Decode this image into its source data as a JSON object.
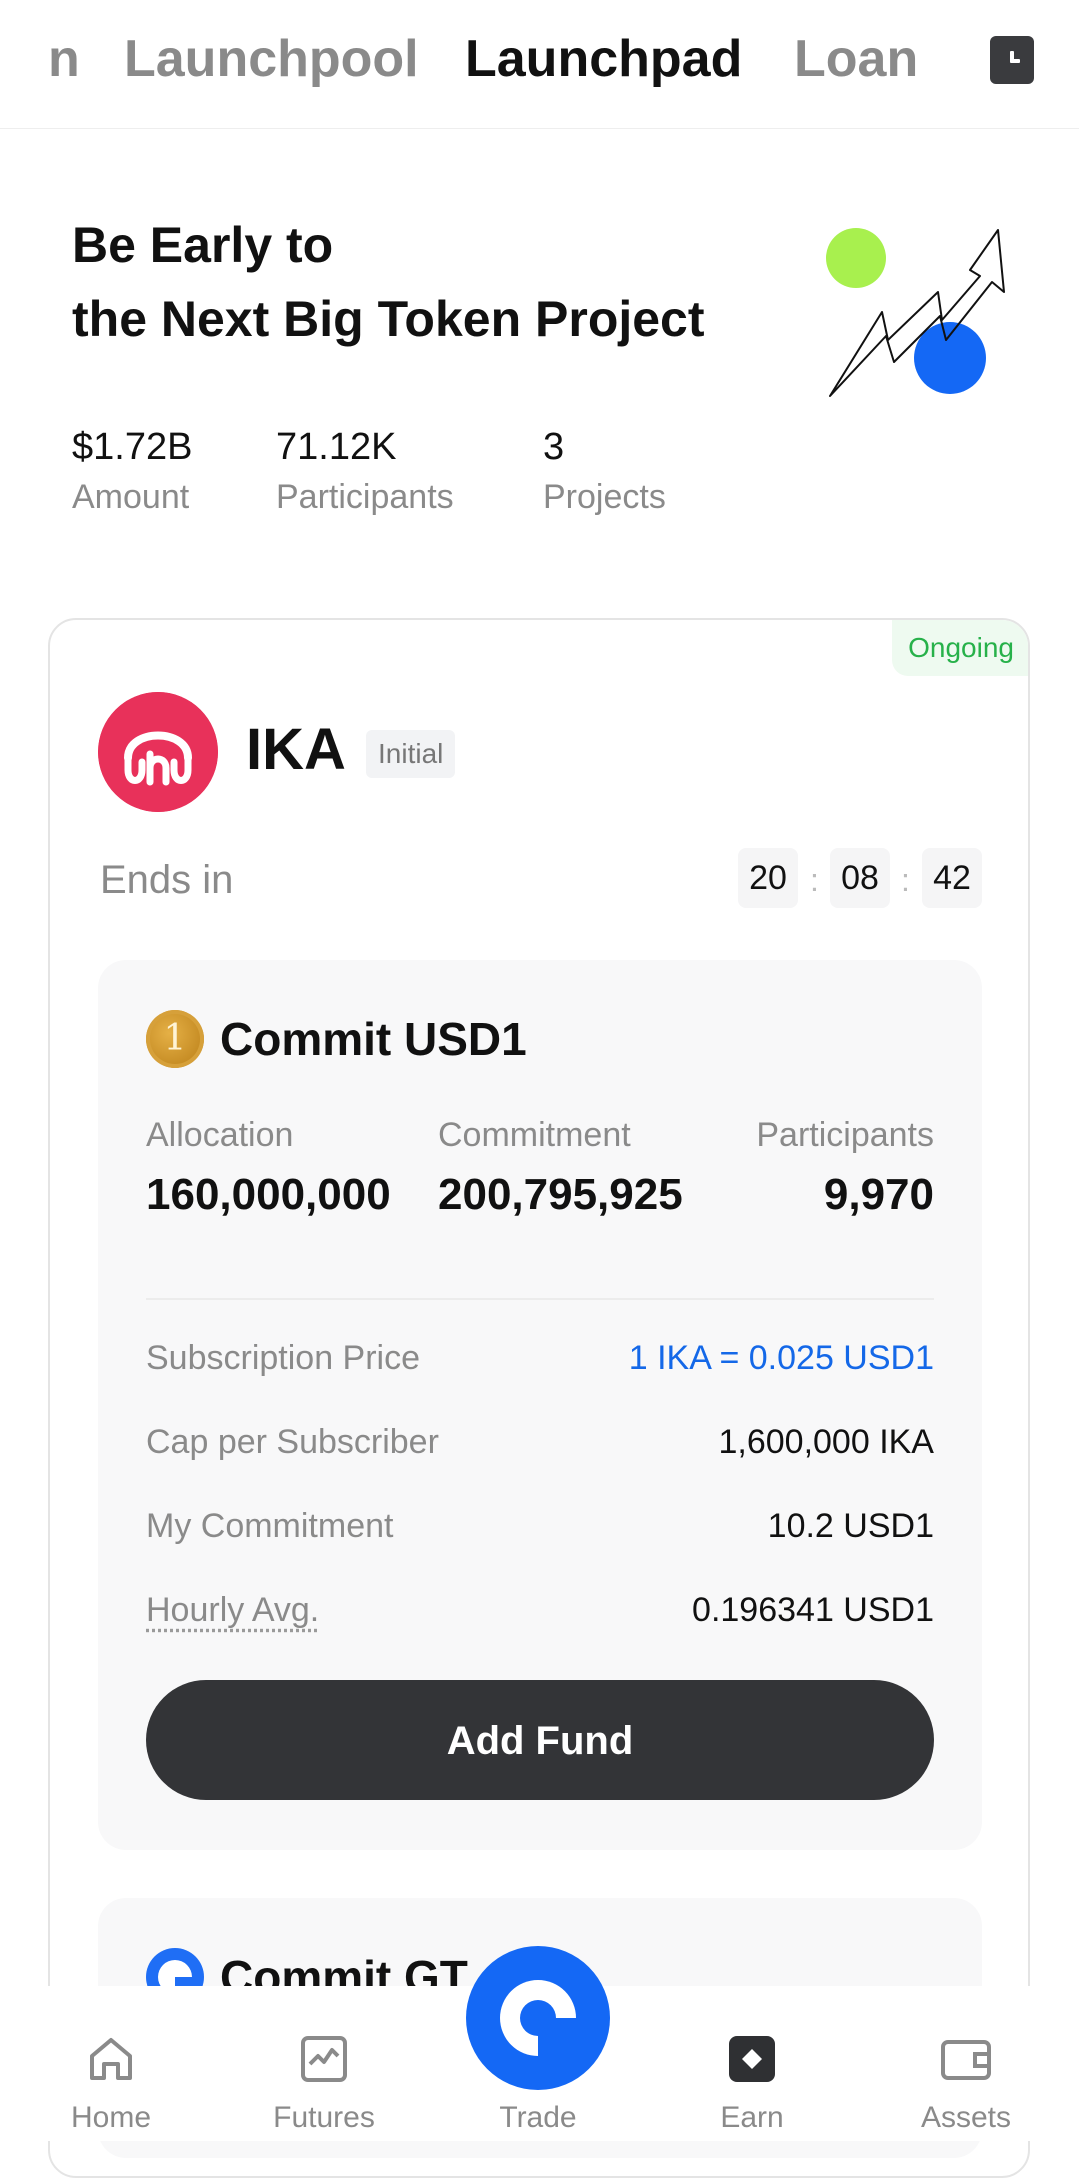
{
  "tabs": [
    {
      "label": "n"
    },
    {
      "label": "Launchpool"
    },
    {
      "label": "Launchpad"
    },
    {
      "label": "Loan"
    }
  ],
  "hero": {
    "title_line1": "Be Early to",
    "title_line2": "the Next Big Token Project"
  },
  "stats": [
    {
      "value": "$1.72B",
      "label": "Amount"
    },
    {
      "value": "71.12K",
      "label": "Participants"
    },
    {
      "value": "3",
      "label": "Projects"
    }
  ],
  "project": {
    "status": "Ongoing",
    "name": "IKA",
    "tag": "Initial",
    "ends_label": "Ends in",
    "timer": {
      "hours": "20",
      "minutes": "08",
      "seconds": "42",
      "sep": ":"
    }
  },
  "pool": {
    "coin_symbol": "1",
    "title": "Commit USD1",
    "metrics": [
      {
        "label": "Allocation",
        "value": "160,000,000"
      },
      {
        "label": "Commitment",
        "value": "200,795,925"
      },
      {
        "label": "Participants",
        "value": "9,970"
      }
    ],
    "rows": [
      {
        "label": "Subscription Price",
        "value": "1 IKA = 0.025 USD1"
      },
      {
        "label": "Cap per Subscriber",
        "value": "1,600,000 IKA"
      },
      {
        "label": "My Commitment",
        "value": "10.2 USD1"
      },
      {
        "label": "Hourly Avg.",
        "value": "0.196341 USD1"
      }
    ],
    "button_label": "Add Fund"
  },
  "pool2": {
    "title": "Commit GT"
  },
  "bottom_nav": [
    {
      "label": "Home",
      "icon": "home-icon"
    },
    {
      "label": "Futures",
      "icon": "futures-icon"
    },
    {
      "label": "Trade",
      "icon": "trade-icon"
    },
    {
      "label": "Earn",
      "icon": "earn-icon"
    },
    {
      "label": "Assets",
      "icon": "assets-icon"
    }
  ],
  "colors": {
    "accent_blue": "#1468f5",
    "status_green": "#27b14a",
    "token_pink": "#e8315a",
    "hero_green": "#a8f04e"
  }
}
